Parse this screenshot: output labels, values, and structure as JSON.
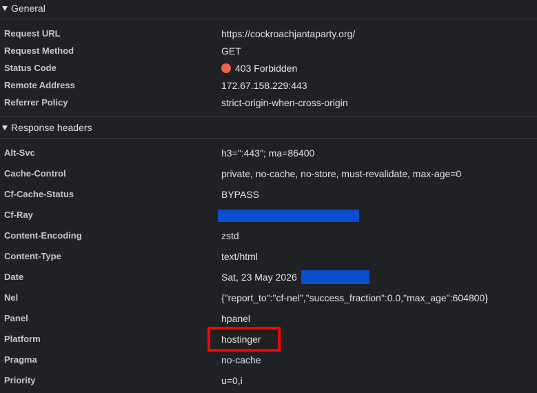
{
  "general": {
    "title": "General",
    "rows": [
      {
        "key": "Request URL",
        "value": "https://cockroachjantaparty.org/"
      },
      {
        "key": "Request Method",
        "value": "GET"
      },
      {
        "key": "Status Code",
        "value": "403 Forbidden"
      },
      {
        "key": "Remote Address",
        "value": "172.67.158.229:443"
      },
      {
        "key": "Referrer Policy",
        "value": "strict-origin-when-cross-origin"
      }
    ]
  },
  "response_headers": {
    "title": "Response headers",
    "rows": [
      {
        "key": "Alt-Svc",
        "value": "h3=\":443\"; ma=86400"
      },
      {
        "key": "Cache-Control",
        "value": "private, no-cache, no-store, must-revalidate, max-age=0"
      },
      {
        "key": "Cf-Cache-Status",
        "value": "BYPASS"
      },
      {
        "key": "Cf-Ray",
        "value": ""
      },
      {
        "key": "Content-Encoding",
        "value": "zstd"
      },
      {
        "key": "Content-Type",
        "value": "text/html"
      },
      {
        "key": "Date",
        "value": "Sat, 23 May 2026"
      },
      {
        "key": "Nel",
        "value": "{\"report_to\":\"cf-nel\",\"success_fraction\":0.0,\"max_age\":604800}"
      },
      {
        "key": "Panel",
        "value": "hpanel"
      },
      {
        "key": "Platform",
        "value": "hostinger"
      },
      {
        "key": "Pragma",
        "value": "no-cache"
      },
      {
        "key": "Priority",
        "value": "u=0,i"
      }
    ]
  },
  "colors": {
    "background": "#202124",
    "status_error": "#f2614f",
    "redaction": "#0a4ecf",
    "highlight": "#ff0000"
  }
}
